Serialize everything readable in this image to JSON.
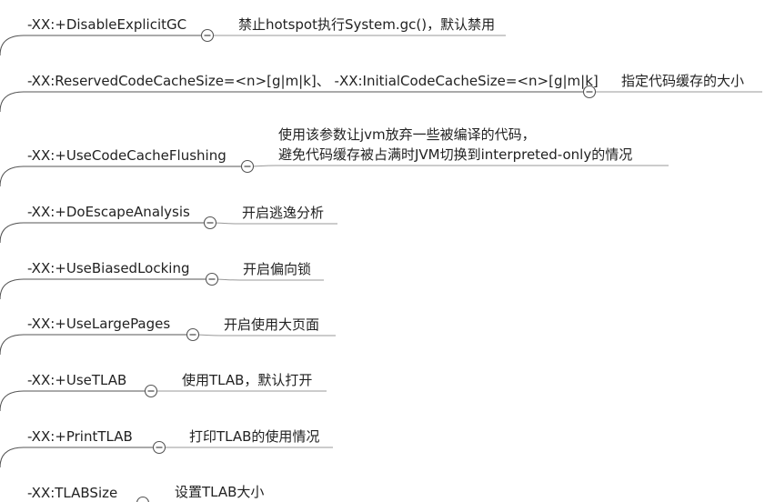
{
  "mindmap": {
    "colors": {
      "line": "#555555",
      "text": "#222222",
      "background": "#ffffff"
    },
    "nodes": [
      {
        "label": "-XX:+DisableExplicitGC",
        "children": [
          "禁止hotspot执行System.gc()，默认禁用"
        ]
      },
      {
        "label": "-XX:ReservedCodeCacheSize=<n>[g|m|k]、 -XX:InitialCodeCacheSize=<n>[g|m|k]",
        "children": [
          "指定代码缓存的大小"
        ]
      },
      {
        "label": "-XX:+UseCodeCacheFlushing",
        "children": [
          "使用该参数让jvm放弃一些被编译的代码，",
          "避免代码缓存被占满时JVM切换到interpreted-only的情况"
        ]
      },
      {
        "label": "-XX:+DoEscapeAnalysis",
        "children": [
          "开启逃逸分析"
        ]
      },
      {
        "label": "-XX:+UseBiasedLocking",
        "children": [
          "开启偏向锁"
        ]
      },
      {
        "label": "-XX:+UseLargePages",
        "children": [
          "开启使用大页面"
        ]
      },
      {
        "label": "-XX:+UseTLAB",
        "children": [
          "使用TLAB，默认打开"
        ]
      },
      {
        "label": "-XX:+PrintTLAB",
        "children": [
          "打印TLAB的使用情况"
        ]
      },
      {
        "label": "-XX:TLABSize",
        "children": [
          "设置TLAB大小"
        ]
      }
    ]
  }
}
